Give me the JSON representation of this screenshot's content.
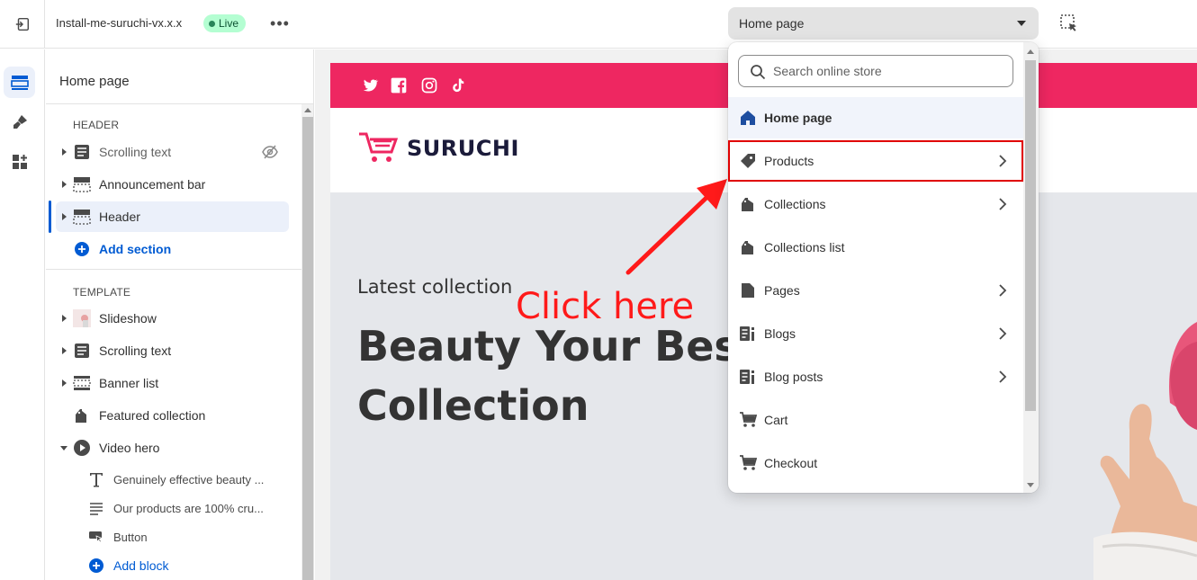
{
  "topbar": {
    "theme_name": "Install-me-suruchi-vx.x.x",
    "status_badge": "Live",
    "more_label": "•••",
    "page_selector": "Home page"
  },
  "sidebar": {
    "title": "Home page",
    "header_group": {
      "label": "HEADER",
      "items": [
        {
          "label": "Scrolling text",
          "icon": "text-block-icon",
          "hidden": true
        },
        {
          "label": "Announcement bar",
          "icon": "section-header-icon"
        },
        {
          "label": "Header",
          "icon": "section-header-icon",
          "selected": true
        }
      ],
      "add_label": "Add section"
    },
    "template_group": {
      "label": "TEMPLATE",
      "items": [
        {
          "label": "Slideshow",
          "icon": "image-thumbnail-icon"
        },
        {
          "label": "Scrolling text",
          "icon": "text-block-icon"
        },
        {
          "label": "Banner list",
          "icon": "section-icon"
        },
        {
          "label": "Featured collection",
          "icon": "collection-tag-icon"
        },
        {
          "label": "Video hero",
          "icon": "play-circle-icon",
          "expanded": true
        }
      ],
      "children": [
        {
          "label": "Genuinely effective beauty ...",
          "icon": "text-t-icon"
        },
        {
          "label": "Our products are 100% cru...",
          "icon": "paragraph-icon"
        },
        {
          "label": "Button",
          "icon": "button-cursor-icon"
        }
      ],
      "add_block_label": "Add block"
    }
  },
  "preview": {
    "brand": "SURUCHI",
    "hero_subtitle": "Latest collection",
    "hero_title": "Beauty Your Best Collection",
    "annotation": "Click here",
    "colors": {
      "promo": "#ee2761",
      "brand_text": "#1b1b3a",
      "annotation": "#ff1a1a"
    }
  },
  "dropdown": {
    "search_placeholder": "Search online store",
    "items": [
      {
        "label": "Home page",
        "icon": "home-icon",
        "current": true,
        "has_children": false
      },
      {
        "label": "Products",
        "icon": "product-tag-icon",
        "has_children": true,
        "highlighted": true
      },
      {
        "label": "Collections",
        "icon": "collection-tag-icon",
        "has_children": true
      },
      {
        "label": "Collections list",
        "icon": "collection-tag-icon",
        "has_children": false
      },
      {
        "label": "Pages",
        "icon": "page-icon",
        "has_children": true
      },
      {
        "label": "Blogs",
        "icon": "blog-icon",
        "has_children": true
      },
      {
        "label": "Blog posts",
        "icon": "blog-icon",
        "has_children": true
      },
      {
        "label": "Cart",
        "icon": "cart-icon",
        "has_children": false
      },
      {
        "label": "Checkout",
        "icon": "cart-icon",
        "has_children": false
      }
    ]
  }
}
